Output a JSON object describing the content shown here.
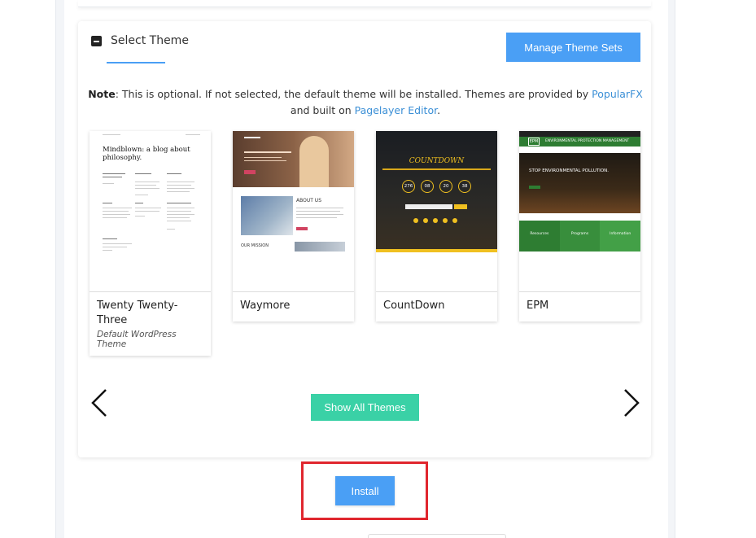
{
  "section": {
    "title": "Select Theme",
    "manage_button": "Manage Theme Sets"
  },
  "note": {
    "label": "Note",
    "text_1": ": This is optional. If not selected, the default theme will be installed. Themes are provided by ",
    "link_1": "PopularFX",
    "text_2": "and built on ",
    "link_2": "Pagelayer Editor",
    "text_3": "."
  },
  "themes": [
    {
      "name": "Twenty Twenty-Three",
      "subtitle": "Default WordPress Theme",
      "thumb_heading": "Mindblown: a blog about philosophy."
    },
    {
      "name": "Waymore",
      "subtitle": "",
      "thumb_about": "ABOUT US",
      "thumb_mission": "OUR MISSION"
    },
    {
      "name": "CountDown",
      "subtitle": "",
      "thumb_title": "COUNTDOWN",
      "thumb_counters": [
        "276",
        "08",
        "20",
        "38"
      ]
    },
    {
      "name": "EPM",
      "subtitle": "",
      "thumb_logo": "EPM",
      "thumb_header": "ENVIRONMENTAL PROTECTION MANAGEMENT",
      "thumb_hero": "STOP ENVIRONMENTAL POLLUTION.",
      "thumb_columns": [
        "Resources",
        "Programs",
        "Information"
      ]
    }
  ],
  "carousel": {
    "prev_icon": "chevron-left-icon",
    "next_icon": "chevron-right-icon"
  },
  "buttons": {
    "show_all": "Show All Themes",
    "install": "Install"
  },
  "colors": {
    "primary_blue": "#4a9ff5",
    "teal": "#3ad1a6",
    "highlight_red": "#e0262e",
    "link": "#3b8fd6"
  }
}
